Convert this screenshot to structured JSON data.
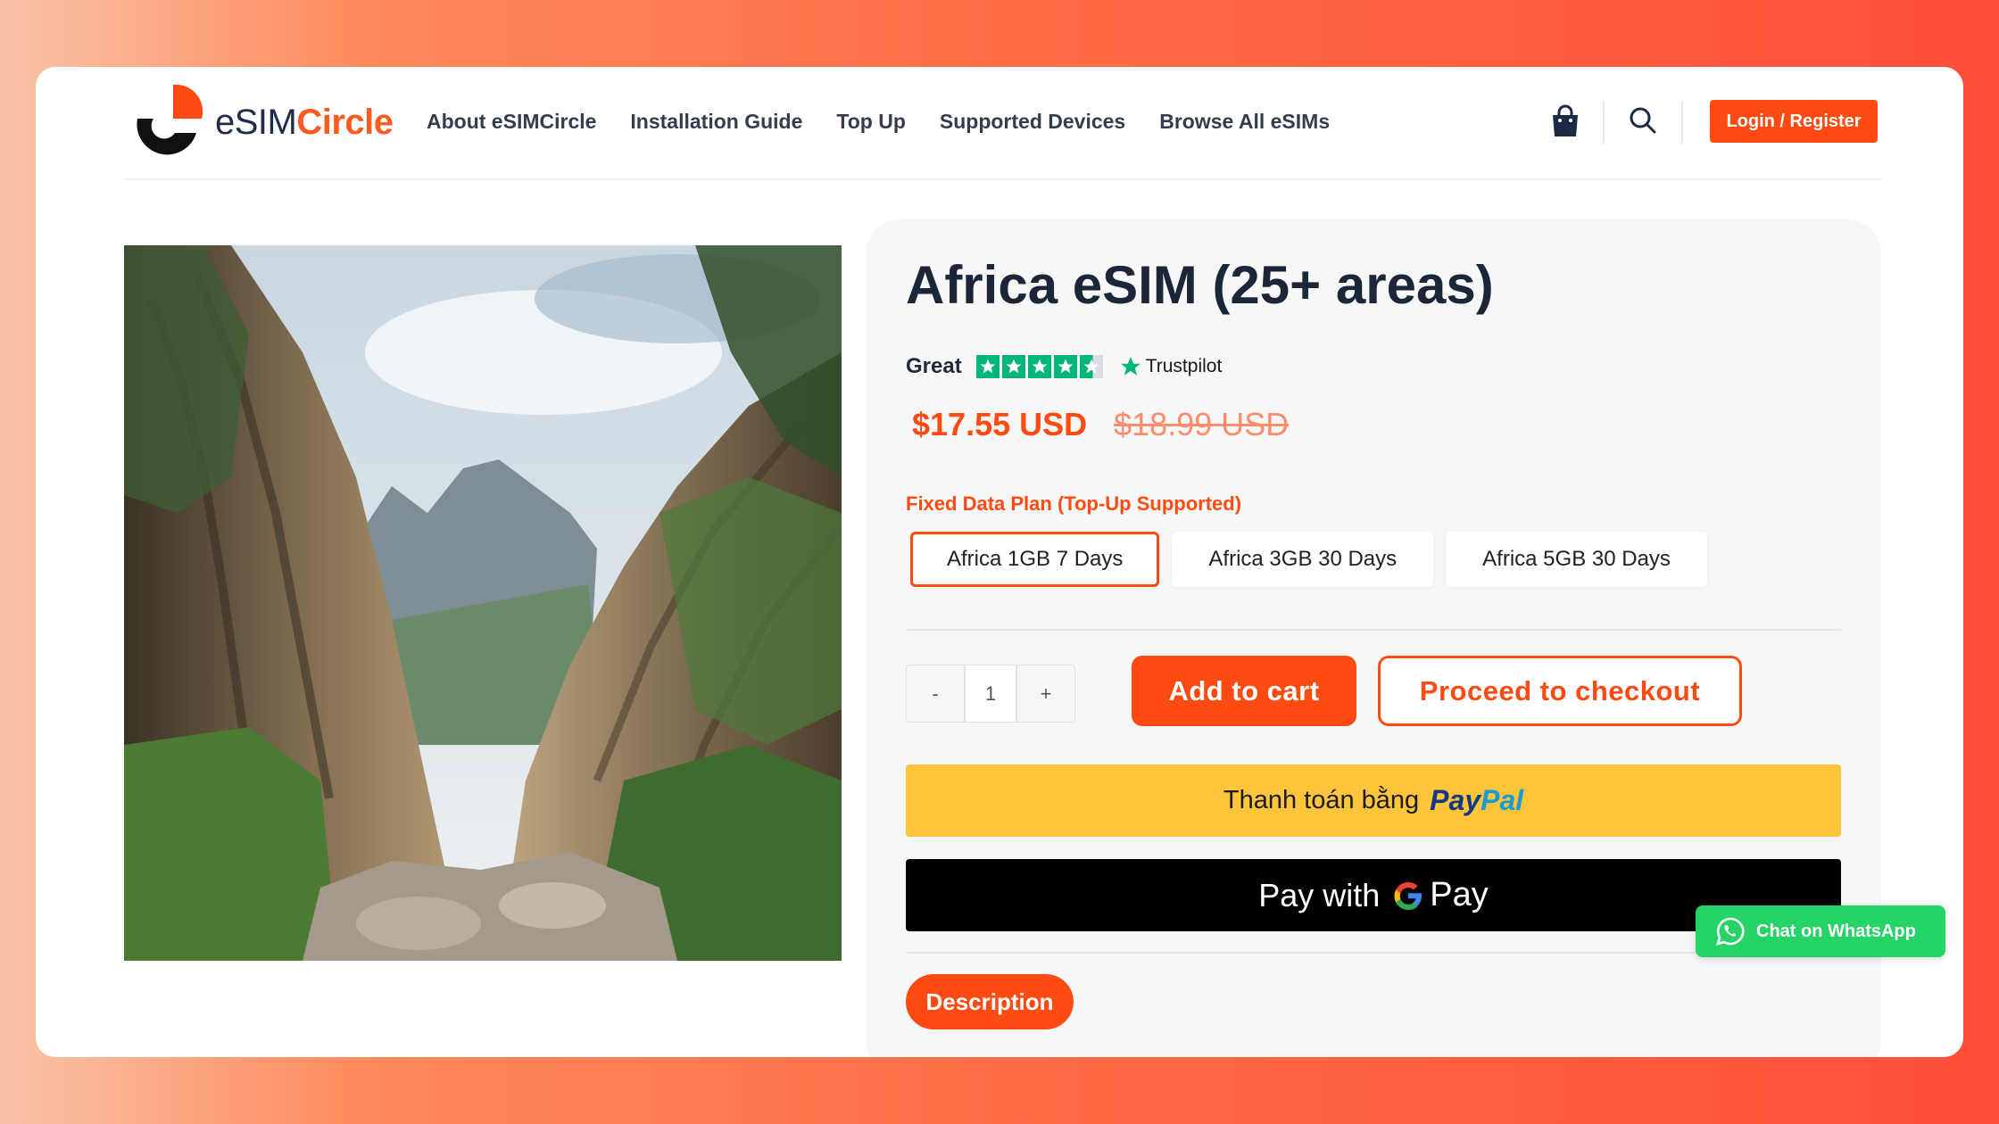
{
  "brand": {
    "name_part1": "eSIM",
    "name_part2": "Circle",
    "accent": "#ff4a12"
  },
  "nav": {
    "items": [
      {
        "label": "About eSIMCircle"
      },
      {
        "label": "Installation Guide"
      },
      {
        "label": "Top Up"
      },
      {
        "label": "Supported Devices"
      },
      {
        "label": "Browse All eSIMs"
      }
    ]
  },
  "header": {
    "cart_icon": "shopping-bag-icon",
    "search_icon": "search-icon",
    "login_label": "Login / Register"
  },
  "product": {
    "image_icon": "canyon-landscape-photo",
    "title": "Africa eSIM (25+ areas)",
    "rating": {
      "label": "Great",
      "stars": 4.5,
      "provider": "Trustpilot"
    },
    "price_current": "$17.55 USD",
    "price_original": "$18.99 USD",
    "plan_label": "Fixed Data Plan (Top-Up Supported)",
    "plans": [
      {
        "label": "Africa 1GB 7 Days",
        "selected": true
      },
      {
        "label": "Africa 3GB 30 Days",
        "selected": false
      },
      {
        "label": "Africa 5GB 30 Days",
        "selected": false
      }
    ],
    "quantity": {
      "minus": "-",
      "value": "1",
      "plus": "+"
    },
    "add_to_cart": "Add to cart",
    "checkout": "Proceed to checkout",
    "paypal": {
      "text": "Thanh toán bằng",
      "logo_pay": "Pay",
      "logo_pal": "Pal"
    },
    "gpay": {
      "text": "Pay with",
      "mark": "Pay"
    },
    "description_tab": "Description"
  },
  "whatsapp": {
    "label": "Chat on WhatsApp",
    "color": "#25d366"
  }
}
